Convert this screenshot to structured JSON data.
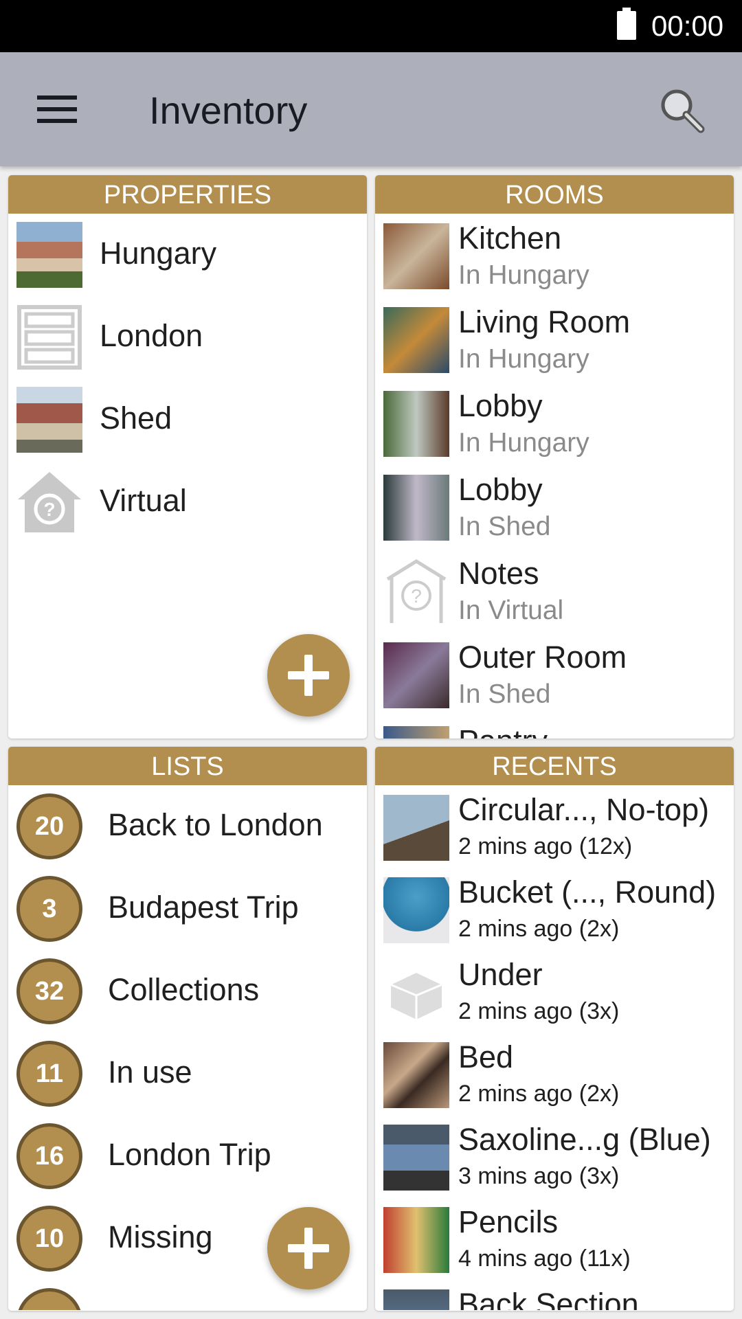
{
  "status": {
    "time": "00:00",
    "battery_icon": "battery-full-icon"
  },
  "appbar": {
    "title": "Inventory",
    "menu_icon": "hamburger-menu-icon",
    "search_icon": "search-icon"
  },
  "colors": {
    "accent": "#b38f4f",
    "appbar": "#adb0bb"
  },
  "properties": {
    "header": "PROPERTIES",
    "items": [
      {
        "name": "Hungary",
        "thumb": "house-photo"
      },
      {
        "name": "London",
        "thumb": "shelves-icon"
      },
      {
        "name": "Shed",
        "thumb": "house-photo"
      },
      {
        "name": "Virtual",
        "thumb": "house-question-icon"
      }
    ]
  },
  "rooms": {
    "header": "ROOMS",
    "items": [
      {
        "name": "Kitchen",
        "location": "In Hungary"
      },
      {
        "name": "Living Room",
        "location": "In Hungary"
      },
      {
        "name": "Lobby",
        "location": "In Hungary"
      },
      {
        "name": "Lobby",
        "location": "In Shed"
      },
      {
        "name": "Notes",
        "location": "In Virtual"
      },
      {
        "name": "Outer Room",
        "location": "In Shed"
      },
      {
        "name": "Pantry",
        "location": ""
      }
    ]
  },
  "lists": {
    "header": "LISTS",
    "items": [
      {
        "count": "20",
        "name": "Back to London"
      },
      {
        "count": "3",
        "name": "Budapest Trip"
      },
      {
        "count": "32",
        "name": "Collections"
      },
      {
        "count": "11",
        "name": "In use"
      },
      {
        "count": "16",
        "name": "London Trip"
      },
      {
        "count": "10",
        "name": "Missing"
      },
      {
        "count": "",
        "name": ""
      }
    ]
  },
  "recents": {
    "header": "RECENTS",
    "items": [
      {
        "name": "Circular..., No-top)",
        "detail": "2 mins ago (12x)"
      },
      {
        "name": "Bucket (..., Round)",
        "detail": "2 mins ago (2x)"
      },
      {
        "name": "Under",
        "detail": "2 mins ago (3x)"
      },
      {
        "name": "Bed",
        "detail": "2 mins ago (2x)"
      },
      {
        "name": "Saxoline...g (Blue)",
        "detail": "3 mins ago (3x)"
      },
      {
        "name": "Pencils",
        "detail": "4 mins ago (11x)"
      },
      {
        "name": "Back Section",
        "detail": ""
      }
    ]
  }
}
